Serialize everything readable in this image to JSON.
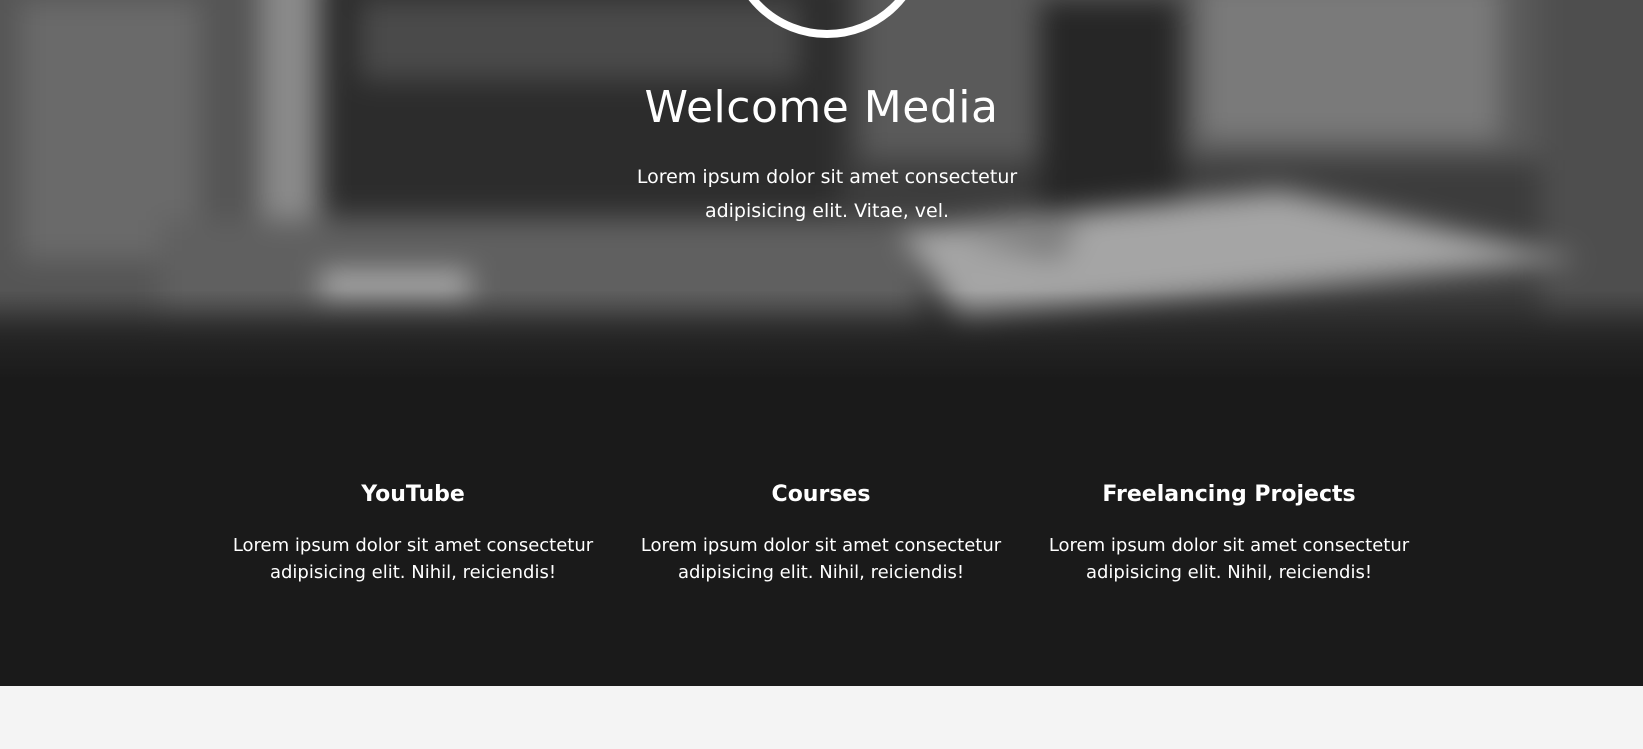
{
  "hero": {
    "title": "Welcome Media",
    "text_line1": "Lorem ipsum dolor sit amet consectetur",
    "text_line2": "adipisicing elit. Vitae, vel."
  },
  "services": [
    {
      "title": "YouTube",
      "text_line1": "Lorem ipsum dolor sit amet consectetur",
      "text_line2": "adipisicing elit. Nihil, reiciendis!"
    },
    {
      "title": "Courses",
      "text_line1": "Lorem ipsum dolor sit amet consectetur",
      "text_line2": "adipisicing elit. Nihil, reiciendis!"
    },
    {
      "title": "Freelancing Projects",
      "text_line1": "Lorem ipsum dolor sit amet consectetur",
      "text_line2": "adipisicing elit. Nihil, reiciendis!"
    }
  ],
  "colors": {
    "hero_overlay": "#3a3a3a",
    "services_background": "#1a1a1a",
    "page_background": "#f4f4f4",
    "text": "#ffffff"
  }
}
